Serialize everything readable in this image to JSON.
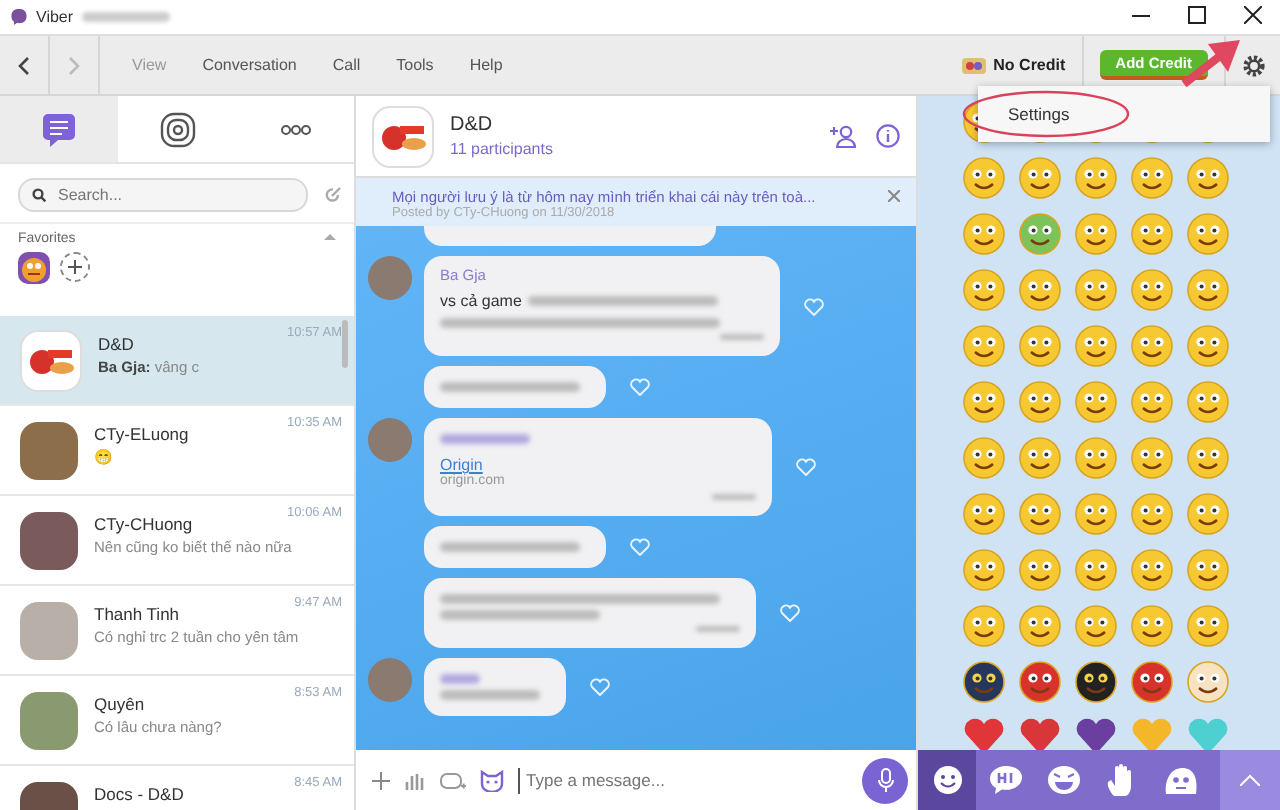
{
  "window": {
    "title": "Viber"
  },
  "toolbar": {
    "menu": [
      {
        "label": "View",
        "disabled": true
      },
      {
        "label": "Conversation",
        "disabled": false
      },
      {
        "label": "Call",
        "disabled": false
      },
      {
        "label": "Tools",
        "disabled": false
      },
      {
        "label": "Help",
        "disabled": false
      }
    ],
    "credit": "No Credit",
    "add_credit": "Add Credit"
  },
  "settings_menu": {
    "items": [
      "Settings"
    ]
  },
  "sidebar": {
    "tabs": [
      {
        "kind": "chats",
        "selected": true
      },
      {
        "kind": "stories",
        "selected": false
      },
      {
        "kind": "more",
        "selected": false
      }
    ],
    "search": {
      "placeholder": "Search..."
    },
    "favorites_label": "Favorites",
    "chats": [
      {
        "name": "D&D",
        "sender": "Ba Gja:",
        "preview": "vâng c",
        "time": "10:57 AM",
        "selected": true,
        "kind": "group"
      },
      {
        "name": "CTy-ELuong",
        "preview": "😁",
        "time": "10:35 AM",
        "selected": false,
        "kind": "person"
      },
      {
        "name": "CTy-CHuong",
        "preview": "Nên cũng ko biết thế nào nữa",
        "time": "10:06 AM",
        "selected": false,
        "kind": "person"
      },
      {
        "name": "Thanh Tinh",
        "preview": "Có nghỉ trc 2 tuần cho yên tâm",
        "time": "9:47 AM",
        "selected": false,
        "kind": "person"
      },
      {
        "name": "Quyên",
        "preview": "Có lâu chưa nàng?",
        "time": "8:53 AM",
        "selected": false,
        "kind": "person"
      },
      {
        "name": "Docs - D&D",
        "time": "8:45 AM",
        "selected": false,
        "kind": "person"
      }
    ]
  },
  "conversation": {
    "title": "D&D",
    "subtitle": "11 participants",
    "pinned": {
      "text": "Mọi người lưu ý là từ hôm nay mình triển khai cái này trên toà...",
      "byline": "Posted by CTy-CHuong on 11/30/2018"
    },
    "messages": [
      {
        "kind": "cut"
      },
      {
        "kind": "text",
        "avatar": true,
        "sender": "Ba Gja",
        "lead": "vs cả game"
      },
      {
        "kind": "blurred",
        "avatar": false
      },
      {
        "kind": "link",
        "avatar": true,
        "link": "Origin",
        "domain": "origin.com"
      },
      {
        "kind": "blurred",
        "avatar": false
      },
      {
        "kind": "blurred2",
        "avatar": false
      },
      {
        "kind": "blurred",
        "avatar": true
      }
    ],
    "input": {
      "placeholder": "Type a message..."
    }
  },
  "emoji_panel": {
    "tabs": [
      {
        "kind": "smile",
        "selected": true
      },
      {
        "kind": "hi",
        "selected": false
      },
      {
        "kind": "laugh",
        "selected": false
      },
      {
        "kind": "hand",
        "selected": false
      },
      {
        "kind": "face",
        "selected": false
      }
    ]
  }
}
